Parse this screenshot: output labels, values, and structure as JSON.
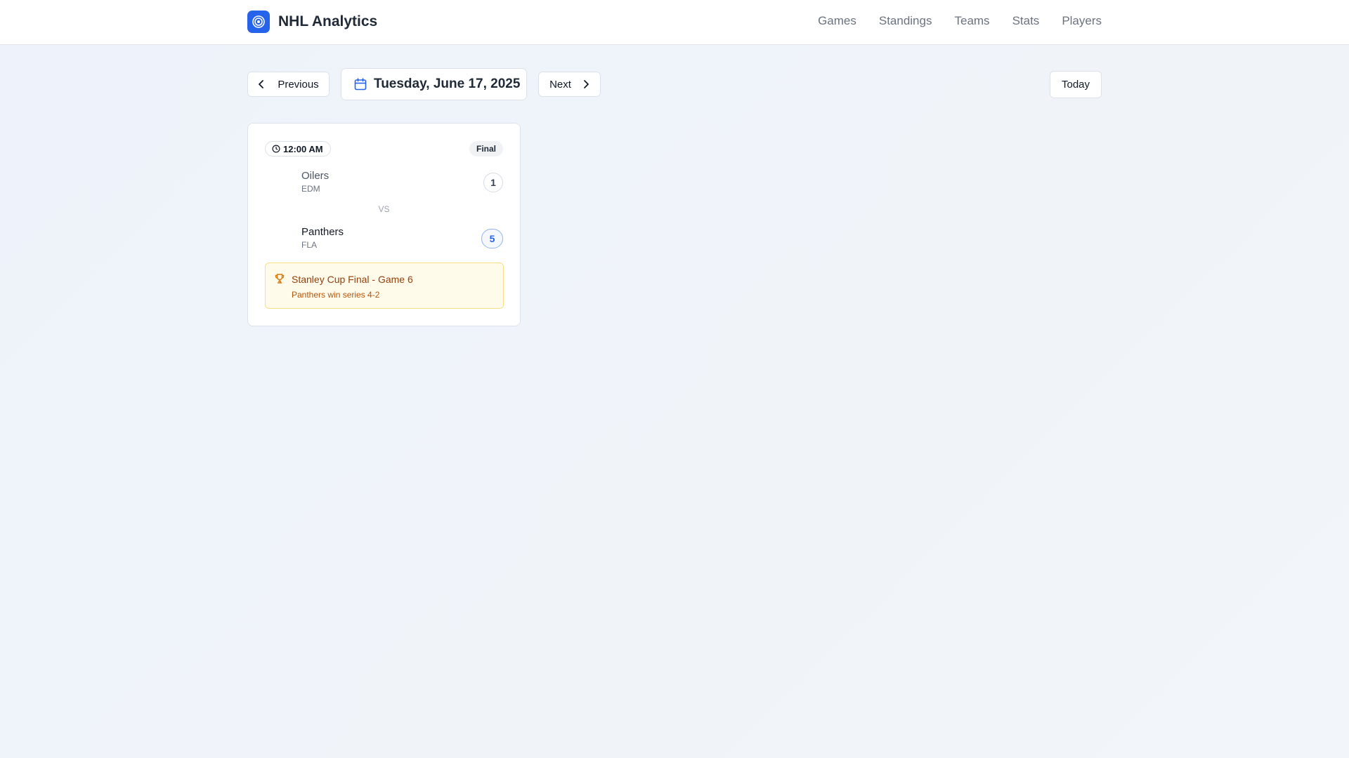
{
  "header": {
    "brand": "NHL Analytics",
    "logo_icon": "target-icon",
    "accent_color": "#2563eb",
    "nav": [
      "Games",
      "Standings",
      "Teams",
      "Stats",
      "Players"
    ]
  },
  "date_nav": {
    "previous_label": "Previous",
    "next_label": "Next",
    "today_label": "Today",
    "current_date": "Tuesday, June 17, 2025"
  },
  "game": {
    "time": "12:00 AM",
    "status": "Final",
    "away": {
      "name": "Oilers",
      "abbr": "EDM",
      "score": "1"
    },
    "vs_label": "VS",
    "home": {
      "name": "Panthers",
      "abbr": "FLA",
      "score": "5"
    },
    "series": {
      "title": "Stanley Cup Final - Game 6",
      "subtitle": "Panthers win series 4-2",
      "icon": "trophy-icon"
    }
  }
}
